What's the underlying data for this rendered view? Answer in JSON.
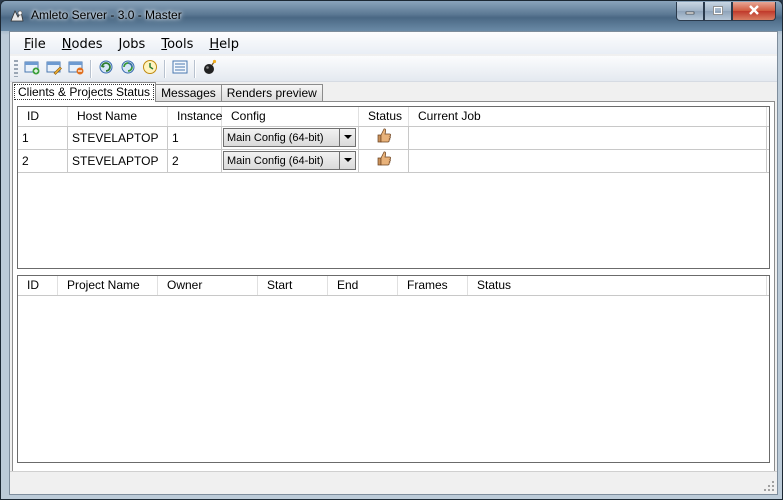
{
  "window": {
    "title": "Amleto Server - 3.0 - Master",
    "controls": [
      "minimize-icon",
      "maximize-icon",
      "close-icon"
    ]
  },
  "menu": [
    {
      "prefix": "",
      "key": "F",
      "rest": "ile"
    },
    {
      "prefix": "",
      "key": "N",
      "rest": "odes"
    },
    {
      "prefix": "",
      "key": "J",
      "rest": "obs"
    },
    {
      "prefix": "",
      "key": "T",
      "rest": "ools"
    },
    {
      "prefix": "",
      "key": "H",
      "rest": "elp"
    }
  ],
  "toolbar": {
    "groups": [
      [
        "add-job-icon",
        "edit-job-icon",
        "remove-job-icon"
      ],
      [
        "refresh-icon",
        "refresh-all-icon",
        "schedule-icon"
      ],
      [
        "list-icon"
      ],
      [
        "bomb-icon"
      ]
    ]
  },
  "tabs": [
    {
      "label": "Clients & Projects Status",
      "active": true
    },
    {
      "label": "Messages",
      "active": false
    },
    {
      "label": "Renders preview",
      "active": false
    }
  ],
  "clients_table": {
    "columns": [
      "ID",
      "Host Name",
      "Instance",
      "Config",
      "Status",
      "Current Job"
    ],
    "rows": [
      {
        "id": "1",
        "host": "STEVELAPTOP",
        "instance": "1",
        "config": "Main Config (64-bit)",
        "status_icon": "thumbs-up-icon",
        "job": ""
      },
      {
        "id": "2",
        "host": "STEVELAPTOP",
        "instance": "2",
        "config": "Main Config (64-bit)",
        "status_icon": "thumbs-up-icon",
        "job": ""
      }
    ]
  },
  "projects_table": {
    "columns": [
      "ID",
      "Project Name",
      "Owner",
      "Start",
      "End",
      "Frames",
      "Status"
    ],
    "rows": []
  },
  "colors": {
    "title_bar": "#5b7893",
    "close_button": "#c0392b",
    "client_bg": "#f0f0f0"
  }
}
